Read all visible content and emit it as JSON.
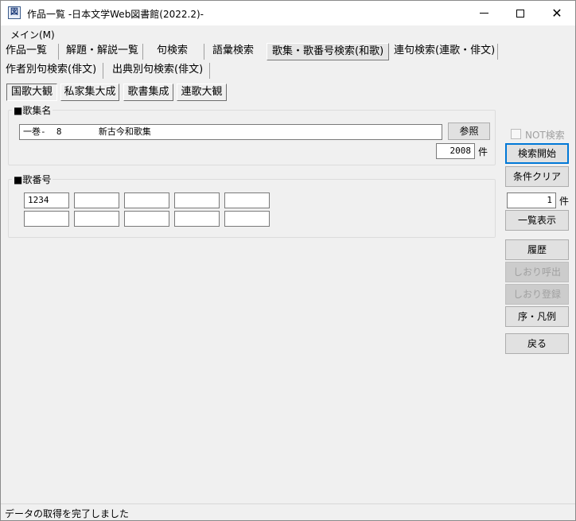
{
  "window": {
    "title": "作品一覧 -日本文学Web図書館(2022.2)-",
    "icon_label": "図"
  },
  "menu": {
    "main_label": "メイン(M)"
  },
  "tabs": [
    "作品一覧",
    "解題・解説一覧",
    "句検索",
    "語彙検索",
    "歌集・歌番号検索(和歌)",
    "連句検索(連歌・俳文)",
    "作者別句検索(俳文)",
    "出典別句検索(俳文)"
  ],
  "sub_tabs": [
    "国歌大観",
    "私家集大成",
    "歌書集成",
    "連歌大観"
  ],
  "kashu": {
    "group_label": "■歌集名",
    "value": "一巻-  8       新古今和歌集",
    "reference_button": "参照",
    "count_value": "2008",
    "count_unit": "件"
  },
  "kabango": {
    "group_label": "■歌番号",
    "fields": [
      "1234",
      "",
      "",
      "",
      "",
      "",
      "",
      "",
      "",
      ""
    ]
  },
  "side": {
    "not_search_label": "NOT検索",
    "search_button": "検索開始",
    "clear_button": "条件クリア",
    "result_count": "1",
    "result_unit": "件",
    "list_button": "一覧表示",
    "history_button": "履歴",
    "bookmark_recall_button": "しおり呼出",
    "bookmark_save_button": "しおり登録",
    "preface_button": "序・凡例",
    "back_button": "戻る"
  },
  "status": {
    "text": "データの取得を完了しました"
  }
}
